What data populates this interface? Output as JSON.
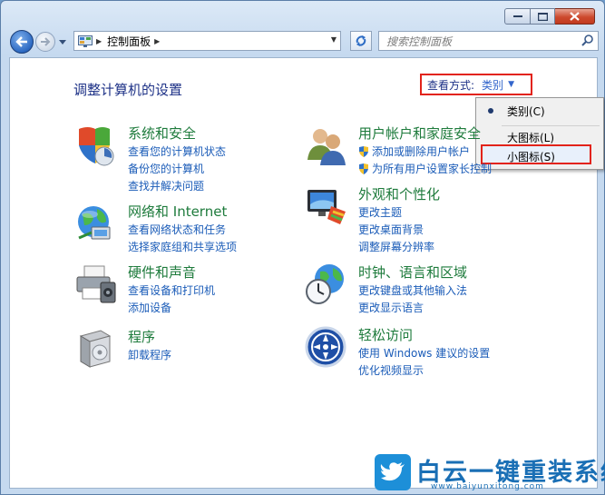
{
  "window": {
    "breadcrumb": "控制面板",
    "search_placeholder": "搜索控制面板"
  },
  "content": {
    "title": "调整计算机的设置",
    "view_by": {
      "label": "查看方式:",
      "value": "类别"
    }
  },
  "view_menu": {
    "items": [
      {
        "label": "类别(C)",
        "selected": true
      },
      {
        "label": "大图标(L)",
        "selected": false
      },
      {
        "label": "小图标(S)",
        "selected": false
      }
    ]
  },
  "categories": [
    {
      "title": "系统和安全",
      "icon": "shield-icon",
      "links": [
        "查看您的计算机状态",
        "备份您的计算机",
        "查找并解决问题"
      ]
    },
    {
      "title": "网络和 Internet",
      "icon": "network-globe-icon",
      "links": [
        "查看网络状态和任务",
        "选择家庭组和共享选项"
      ]
    },
    {
      "title": "硬件和声音",
      "icon": "printer-icon",
      "links": [
        "查看设备和打印机",
        "添加设备"
      ]
    },
    {
      "title": "程序",
      "icon": "programs-box-icon",
      "links": [
        "卸载程序"
      ]
    },
    {
      "title": "用户帐户和家庭安全",
      "icon": "users-icon",
      "links": [
        "添加或删除用户帐户",
        "为所有用户设置家长控制"
      ]
    },
    {
      "title": "外观和个性化",
      "icon": "monitor-palette-icon",
      "links": [
        "更改主题",
        "更改桌面背景",
        "调整屏幕分辨率"
      ]
    },
    {
      "title": "时钟、语言和区域",
      "icon": "clock-globe-icon",
      "links": [
        "更改键盘或其他输入法",
        "更改显示语言"
      ]
    },
    {
      "title": "轻松访问",
      "icon": "ease-of-access-icon",
      "links": [
        "使用 Windows 建议的设置",
        "优化视频显示"
      ]
    }
  ],
  "watermark": {
    "brand": "白云一键重装系统",
    "url": "www.baiyunxitong.com"
  }
}
